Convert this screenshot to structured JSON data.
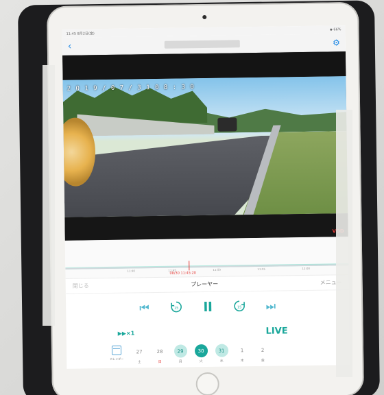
{
  "status_bar": {
    "left": "11:45  8月2日(金)",
    "right": "◆ 66%"
  },
  "nav": {
    "back_icon": "chevron-left-icon",
    "settings_icon": "gear-icon"
  },
  "video": {
    "overlay_title": "2 0 1 9 / 0 7 / 3 1  0 8 : 3 0",
    "rec_label": "VOD"
  },
  "timeline": {
    "ticks": [
      "11:40",
      "11:45",
      "11:50",
      "11:55",
      "12:00"
    ],
    "cursor_time": "08/30 11:45:20"
  },
  "player": {
    "left_label": "閉じる",
    "title": "プレーヤー",
    "menu_label": "メニュー"
  },
  "controls": {
    "skip_back_icon": "skip-previous-icon",
    "rewind_icon": "rewind-15-icon",
    "pause_icon": "pause-icon",
    "forward_icon": "forward-15-icon",
    "skip_next_icon": "skip-next-icon",
    "rewind_text": "15",
    "forward_text": "15"
  },
  "speed_label": "▶▶×1",
  "live_label": "LIVE",
  "calendar": {
    "label": "カレンダー",
    "days": [
      {
        "num": "27",
        "weekday": "土",
        "state": "normal"
      },
      {
        "num": "28",
        "weekday": "日",
        "state": "sunday"
      },
      {
        "num": "29",
        "weekday": "月",
        "state": "range"
      },
      {
        "num": "30",
        "weekday": "火",
        "state": "selected"
      },
      {
        "num": "31",
        "weekday": "水",
        "state": "range"
      },
      {
        "num": "1",
        "weekday": "木",
        "state": "normal"
      },
      {
        "num": "2",
        "weekday": "金",
        "state": "normal"
      }
    ]
  },
  "colors": {
    "accent": "#1aa79b",
    "nav_blue": "#1e88e5",
    "rec_red": "#e53935"
  }
}
